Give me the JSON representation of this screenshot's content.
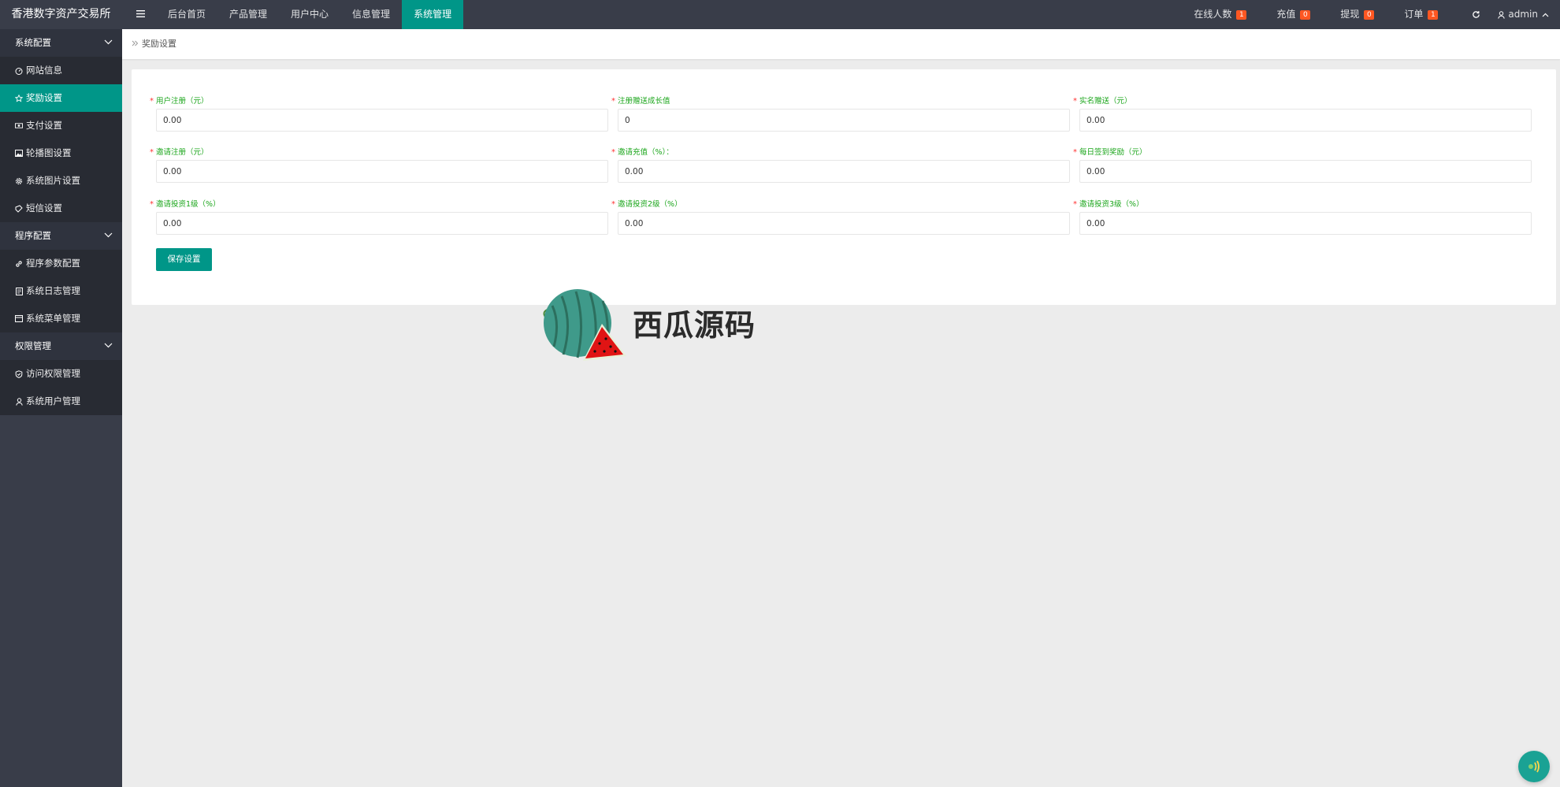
{
  "header": {
    "brand": "香港数字资产交易所",
    "nav": [
      {
        "label": "后台首页"
      },
      {
        "label": "产品管理"
      },
      {
        "label": "用户中心"
      },
      {
        "label": "信息管理"
      },
      {
        "label": "系统管理",
        "active": true
      }
    ],
    "stats": [
      {
        "label": "在线人数",
        "count": "1"
      },
      {
        "label": "充值",
        "count": "0"
      },
      {
        "label": "提现",
        "count": "0"
      },
      {
        "label": "订单",
        "count": "1"
      }
    ],
    "user": "admin"
  },
  "sidebar": {
    "groups": [
      {
        "label": "系统配置",
        "items": [
          {
            "label": "网站信息",
            "icon": "dashboard-icon"
          },
          {
            "label": "奖励设置",
            "icon": "star-icon",
            "active": true
          },
          {
            "label": "支付设置",
            "icon": "cash-icon"
          },
          {
            "label": "轮播图设置",
            "icon": "image-icon"
          },
          {
            "label": "系统图片设置",
            "icon": "gear-icon"
          },
          {
            "label": "短信设置",
            "icon": "message-icon"
          }
        ]
      },
      {
        "label": "程序配置",
        "items": [
          {
            "label": "程序参数配置",
            "icon": "link-icon"
          },
          {
            "label": "系统日志管理",
            "icon": "log-icon"
          },
          {
            "label": "系统菜单管理",
            "icon": "table-icon"
          }
        ]
      },
      {
        "label": "权限管理",
        "items": [
          {
            "label": "访问权限管理",
            "icon": "shield-icon"
          },
          {
            "label": "系统用户管理",
            "icon": "user-icon"
          }
        ]
      }
    ]
  },
  "breadcrumb": {
    "current": "奖励设置"
  },
  "form": {
    "fields": [
      {
        "label": "用户注册（元）",
        "value": "0.00"
      },
      {
        "label": "注册赠送成长值",
        "value": "0"
      },
      {
        "label": "实名赠送（元）",
        "value": "0.00"
      },
      {
        "label": "邀请注册（元）",
        "value": "0.00"
      },
      {
        "label": "邀请充值（%）：",
        "value": "0.00"
      },
      {
        "label": "每日签到奖励（元）",
        "value": "0.00"
      },
      {
        "label": "邀请投资1级（%）",
        "value": "0.00"
      },
      {
        "label": "邀请投资2级（%）",
        "value": "0.00"
      },
      {
        "label": "邀请投资3级（%）",
        "value": "0.00"
      }
    ],
    "save_label": "保存设置"
  },
  "watermark": {
    "text": "西瓜源码"
  },
  "colors": {
    "accent": "#009688",
    "topbar": "#393d49",
    "badge": "#ff5722",
    "label": "#1aa51a",
    "required": "#ff3333"
  }
}
